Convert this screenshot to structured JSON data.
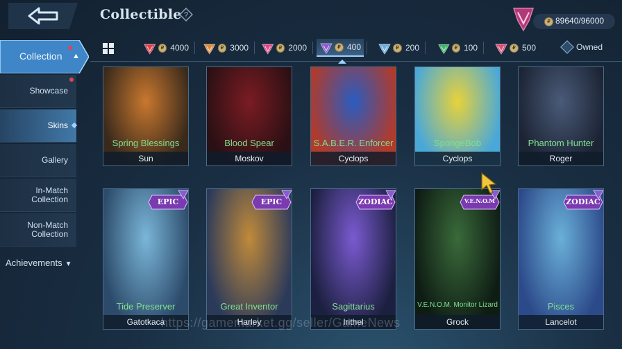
{
  "header": {
    "title": "Collectible",
    "points": "89640/96000"
  },
  "filters": {
    "tiers": [
      {
        "value": "4000",
        "color": "#e0404a"
      },
      {
        "value": "3000",
        "color": "#e08a3a"
      },
      {
        "value": "2000",
        "color": "#e04a8a"
      },
      {
        "value": "400",
        "color": "#8a5ad6"
      },
      {
        "value": "200",
        "color": "#6aaee0"
      },
      {
        "value": "100",
        "color": "#3cb86a"
      },
      {
        "value": "500",
        "color": "#d8507a"
      }
    ],
    "owned_label": "Owned"
  },
  "sidebar": {
    "collection_label": "Collection",
    "items": [
      {
        "label": "Showcase"
      },
      {
        "label": "Skins"
      },
      {
        "label": "Gallery"
      },
      {
        "label": "In-Match Collection"
      },
      {
        "label": "Non-Match Collection"
      }
    ],
    "achievements_label": "Achievements"
  },
  "skins": [
    {
      "skin": "Spring Blessings",
      "hero": "Sun",
      "colors": [
        "#c9782e",
        "#3a2a1c"
      ]
    },
    {
      "skin": "Blood Spear",
      "hero": "Moskov",
      "colors": [
        "#7a1c22",
        "#2a1014"
      ]
    },
    {
      "skin": "S.A.B.E.R. Enforcer",
      "hero": "Cyclops",
      "colors": [
        "#2a5cc0",
        "#b23a2a"
      ]
    },
    {
      "skin": "SpongeBob",
      "hero": "Cyclops",
      "colors": [
        "#e8d23a",
        "#4aa8d8"
      ]
    },
    {
      "skin": "Phantom Hunter",
      "hero": "Roger",
      "colors": [
        "#4a5a78",
        "#1c2434"
      ]
    },
    {
      "skin": "Tide Preserver",
      "hero": "Gatotkaca",
      "colors": [
        "#7ab6d8",
        "#2c4a6a"
      ],
      "badge": "EPIC"
    },
    {
      "skin": "Great Inventor",
      "hero": "Harley",
      "colors": [
        "#c08a3a",
        "#2c3a5a"
      ],
      "badge": "EPIC"
    },
    {
      "skin": "Sagittarius",
      "hero": "Irithel",
      "colors": [
        "#7a5ad0",
        "#1c2040"
      ],
      "badge": "ZODIAC"
    },
    {
      "skin": "V.E.N.O.M. Monitor Lizard",
      "hero": "Grock",
      "colors": [
        "#3a6a3a",
        "#0e1c14"
      ],
      "badge": "V.E.N.O.M"
    },
    {
      "skin": "Pisces",
      "hero": "Lancelot",
      "colors": [
        "#6ab0d8",
        "#2c4a8a"
      ],
      "badge": "ZODIAC"
    }
  ],
  "watermark": "https://gamemarket.gg/seller/GameNews"
}
